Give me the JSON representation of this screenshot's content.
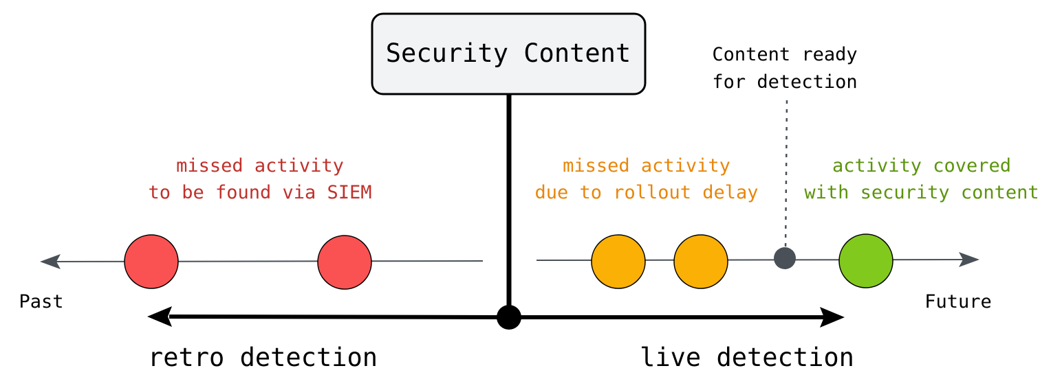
{
  "title_box": {
    "label": "Security Content"
  },
  "marker_label": {
    "lines": [
      "Content ready",
      "for detection"
    ]
  },
  "groups": {
    "retro_missed": {
      "lines": [
        "missed activity",
        "to be found via SIEM"
      ],
      "color": "#c0312b",
      "dot_color": "#fa5252",
      "dot_count": 2
    },
    "rollout_missed": {
      "lines": [
        "missed activity",
        "due to rollout delay"
      ],
      "color": "#e8860a",
      "dot_color": "#fab005",
      "dot_count": 2
    },
    "covered": {
      "lines": [
        "activity covered",
        "with security content"
      ],
      "color": "#5c940d",
      "dot_color": "#82c91e",
      "dot_count": 1
    }
  },
  "timeline": {
    "past_label": "Past",
    "future_label": "Future"
  },
  "detection": {
    "retro_label": "retro detection",
    "live_label": "live detection"
  },
  "colors": {
    "timeline_line": "#495057",
    "ink": "#000000",
    "box_fill": "#f1f3f5",
    "marker_dot": "#495057"
  }
}
